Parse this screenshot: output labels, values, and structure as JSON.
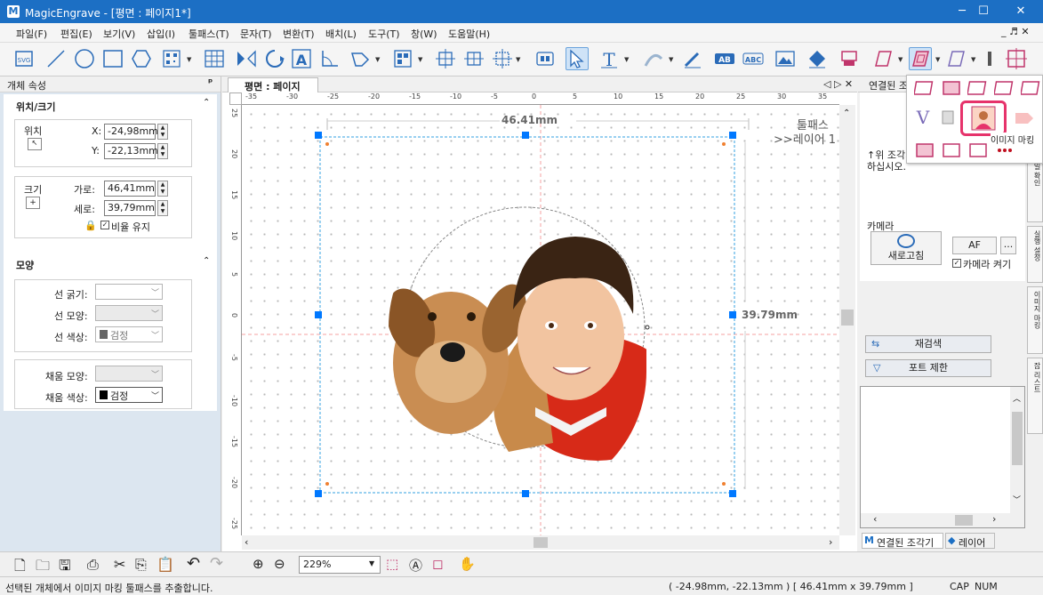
{
  "window": {
    "title": "MagicEngrave - [평면 : 페이지1*]",
    "min": "─",
    "max": "☐",
    "close": "✕"
  },
  "menu": [
    "파일(F)",
    "편집(E)",
    "보기(V)",
    "삽입(I)",
    "툴패스(T)",
    "문자(T)",
    "변환(T)",
    "배치(L)",
    "도구(T)",
    "창(W)",
    "도움말(H)"
  ],
  "mdi_controls": "_ ♬ ✕",
  "left_panel": {
    "title": "개체 속성",
    "pin": "ᵖ",
    "section_pos_size": "위치/크기",
    "pos_label": "위치",
    "x_label": "X:",
    "x_value": "-24,98mm",
    "y_label": "Y:",
    "y_value": "-22,13mm",
    "size_label": "크기",
    "w_label": "가로:",
    "w_value": "46,41mm",
    "h_label": "세로:",
    "h_value": "39,79mm",
    "keep_ratio": "비율 유지",
    "section_shape": "모양",
    "line_width_label": "선 굵기:",
    "line_style_label": "선 모양:",
    "line_color_label": "선 색상:",
    "line_color_value": "검정",
    "fill_style_label": "채움 모양:",
    "fill_color_label": "채움 색상:",
    "fill_color_value": "검정"
  },
  "doc": {
    "tab": "평면 : 페이지1*",
    "nav": "◁ ▷ ✕",
    "width_dim": "46.41mm",
    "height_dim": "39.79mm",
    "toolpath_label": "툴패스",
    "layer_label": ">>레이어 1",
    "hruler_ticks": [
      "-35",
      "-30",
      "-25",
      "-20",
      "-15",
      "-10",
      "-5",
      "0",
      "5",
      "10",
      "15",
      "20",
      "25",
      "30",
      "35"
    ],
    "vruler_ticks": [
      "25",
      "20",
      "15",
      "10",
      "5",
      "0",
      "-5",
      "-10",
      "-15",
      "-20",
      "-25"
    ]
  },
  "right_panel": {
    "title": "연결된 조각기",
    "message": "↑위 조각기...\n하십시오.",
    "camera_label": "카메라",
    "refresh": "새로고침",
    "af": "AF",
    "more": "...",
    "camera_on": "카메라 켜기",
    "rescan": "재검색",
    "port_limit": "포트 제한",
    "tab_connected": "연결된 조각기",
    "tab_layer": "레이어",
    "side_tabs": [
      "파일 확인",
      "실행 설정",
      "이미지 마킹",
      "잡 리스트"
    ]
  },
  "popup": {
    "tooltip": "이미지 마킹"
  },
  "bottom": {
    "zoom": "229%"
  },
  "status": {
    "message": "선택된 개체에서 이미지 마킹 툴패스를 추출합니다.",
    "coords": "( -24.98mm, -22.13mm )  [ 46.41mm x 39.79mm ]",
    "cap": "CAP",
    "num": "NUM"
  },
  "colors": {
    "accent": "#1c6fc4",
    "selection": "#0078ff",
    "highlight": "#e6336b"
  }
}
